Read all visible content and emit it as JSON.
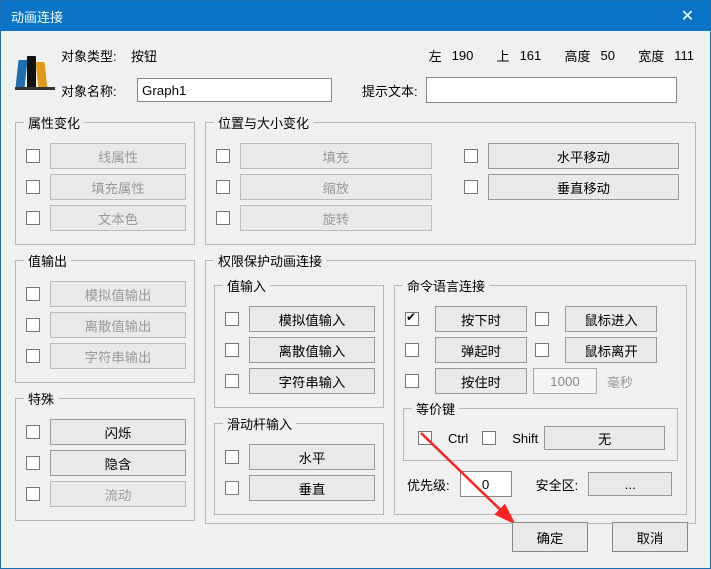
{
  "dialog": {
    "title": "动画连接",
    "close": "✕"
  },
  "header": {
    "obj_type_label": "对象类型:",
    "obj_type_value": "按钮",
    "obj_name_label": "对象名称:",
    "obj_name_value": "Graph1",
    "tip_label": "提示文本:",
    "geom": {
      "left_label": "左",
      "left_val": "190",
      "top_label": "上",
      "top_val": "161",
      "height_label": "高度",
      "height_val": "50",
      "width_label": "宽度",
      "width_val": "111"
    }
  },
  "groups": {
    "attr_change": {
      "legend": "属性变化",
      "items": [
        {
          "label": "线属性",
          "enabled": false
        },
        {
          "label": "填充属性",
          "enabled": false
        },
        {
          "label": "文本色",
          "enabled": false
        }
      ]
    },
    "value_output": {
      "legend": "值输出",
      "items": [
        {
          "label": "模拟值输出",
          "enabled": false
        },
        {
          "label": "离散值输出",
          "enabled": false
        },
        {
          "label": "字符串输出",
          "enabled": false
        }
      ]
    },
    "special": {
      "legend": "特殊",
      "items": [
        {
          "label": "闪烁",
          "enabled": true
        },
        {
          "label": "隐含",
          "enabled": true
        },
        {
          "label": "流动",
          "enabled": false
        }
      ]
    },
    "pos_size": {
      "legend": "位置与大小变化",
      "left": [
        {
          "label": "填充",
          "enabled": false
        },
        {
          "label": "缩放",
          "enabled": false
        },
        {
          "label": "旋转",
          "enabled": false
        }
      ],
      "right": [
        {
          "label": "水平移动",
          "enabled": true
        },
        {
          "label": "垂直移动",
          "enabled": true
        }
      ]
    },
    "perm_anim": {
      "legend": "权限保护动画连接"
    },
    "value_input": {
      "legend": "值输入",
      "items": [
        {
          "label": "模拟值输入",
          "enabled": true
        },
        {
          "label": "离散值输入",
          "enabled": true
        },
        {
          "label": "字符串输入",
          "enabled": true
        }
      ]
    },
    "slider_input": {
      "legend": "滑动杆输入",
      "items": [
        {
          "label": "水平",
          "enabled": true
        },
        {
          "label": "垂直",
          "enabled": true
        }
      ]
    },
    "cmd_lang": {
      "legend": "命令语言连接",
      "rows": [
        {
          "label": "按下时",
          "checked": true,
          "right": {
            "label": "鼠标进入"
          }
        },
        {
          "label": "弹起时",
          "checked": false,
          "right": {
            "label": "鼠标离开"
          }
        },
        {
          "label": "按住时",
          "checked": false,
          "interval": "1000",
          "unit": "毫秒"
        }
      ],
      "equiv": {
        "legend": "等价键",
        "ctrl": "Ctrl",
        "shift": "Shift",
        "none": "无"
      }
    },
    "bottom": {
      "priority_label": "优先级:",
      "priority_value": "0",
      "sec_label": "安全区:",
      "sec_btn": "..."
    }
  },
  "buttons": {
    "ok": "确定",
    "cancel": "取消"
  }
}
